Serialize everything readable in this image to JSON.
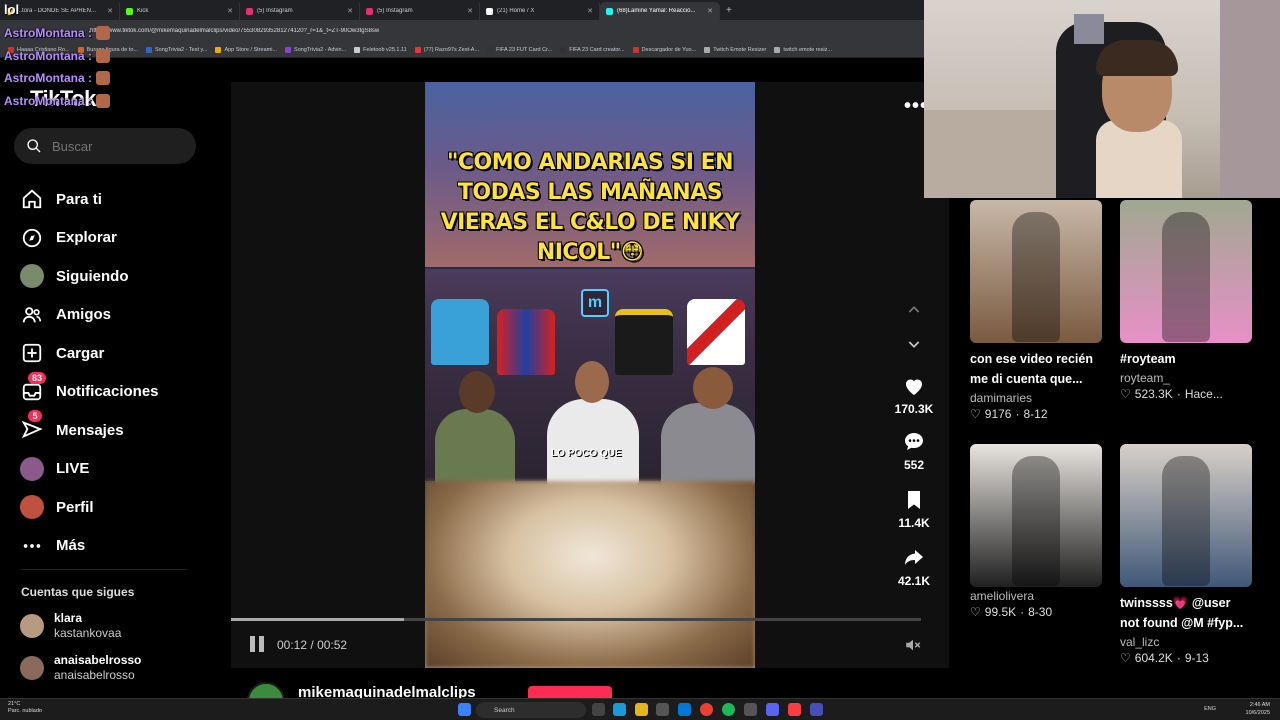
{
  "browser": {
    "tabs": [
      {
        "label": "...tora - DONDE SE APREN...",
        "color": "#f0c040"
      },
      {
        "label": "Kick",
        "color": "#53fc18"
      },
      {
        "label": "(5) Instagram",
        "color": "#e1306c"
      },
      {
        "label": "(5) Instagram",
        "color": "#e1306c"
      },
      {
        "label": "(21) Home / X",
        "color": "#ffffff"
      },
      {
        "label": "(68)Lamine Yamal: Reacció...",
        "color": "#25f4ee",
        "active": true
      }
    ],
    "new_tab": "+",
    "url": "https://www.tiktok.com/@mikemaquinadelmalclips/video/7553082935281274120?_r=1&_t=ZT-90Ow3tgS8sw",
    "bookmarks": [
      {
        "label": "Haaaa Cristiano Ro...",
        "color": "#cc3333"
      },
      {
        "label": "Burago figura de to...",
        "color": "#cc6633"
      },
      {
        "label": "SongTrivia2 - Test y...",
        "color": "#3366cc"
      },
      {
        "label": "App Store / Streami...",
        "color": "#eeaa00"
      },
      {
        "label": "SongTrivia2 - Advin...",
        "color": "#8844cc"
      },
      {
        "label": "Feletoob v25.1.11",
        "color": "#cccccc"
      },
      {
        "label": "(77) Razo97s Zest-A...",
        "color": "#ee3333"
      },
      {
        "label": "FIFA 23 FUT Card Cr...",
        "color": "#333333"
      },
      {
        "label": "FIFA 23 Card creator...",
        "color": "#333333"
      },
      {
        "label": "Descargador de Yuo...",
        "color": "#cc3333"
      },
      {
        "label": "Twitch Emote Resizer",
        "color": "#aaaaaa"
      },
      {
        "label": "twitch emote resiz...",
        "color": "#aaaaaa"
      }
    ]
  },
  "chat": {
    "top_text": "lol",
    "messages": [
      {
        "user": "AstroMontana :"
      },
      {
        "user": "AstroMontana :"
      },
      {
        "user": "AstroMontana :"
      },
      {
        "user": "AstroMontana :"
      }
    ]
  },
  "sidebar": {
    "logo": "TikTok",
    "search_placeholder": "Buscar",
    "items": [
      {
        "label": "Para ti",
        "icon": "home-icon"
      },
      {
        "label": "Explorar",
        "icon": "compass-icon"
      },
      {
        "label": "Siguiendo",
        "icon": "following-avatar"
      },
      {
        "label": "Amigos",
        "icon": "friends-icon"
      },
      {
        "label": "Cargar",
        "icon": "upload-icon"
      },
      {
        "label": "Notificaciones",
        "icon": "inbox-icon",
        "badge": "83"
      },
      {
        "label": "Mensajes",
        "icon": "message-icon",
        "badge": "5"
      },
      {
        "label": "LIVE",
        "icon": "live-avatar"
      },
      {
        "label": "Perfil",
        "icon": "profile-avatar"
      },
      {
        "label": "Más",
        "icon": "more-icon"
      }
    ],
    "following_title": "Cuentas que sigues",
    "following": [
      {
        "name": "klara",
        "sub": "kastankovaa"
      },
      {
        "name": "anaisabelrosso",
        "sub": "anaisabelrosso"
      }
    ]
  },
  "video": {
    "headline": "\"COMO ANDARIAS SI EN TODAS LAS MAÑANAS VIERAS EL C&LO DE NIKY NICOL\"😳",
    "caption": "LO POCO QUE",
    "logo_letter": "m",
    "current_time": "00:12",
    "duration": "00:52",
    "separator": "/",
    "progress": 0.25,
    "author": "mikemaquinadelmalclips"
  },
  "actions": [
    {
      "icon": "heart-icon",
      "count": "170.3K"
    },
    {
      "icon": "comment-icon",
      "count": "552"
    },
    {
      "icon": "bookmark-icon",
      "count": "11.4K"
    },
    {
      "icon": "share-icon",
      "count": "42.1K"
    }
  ],
  "related": [
    {
      "desc": "con ese video recién me di cuenta que...",
      "user": "damimaries",
      "likes": "9176",
      "date": "8-12",
      "colors": [
        "#c8b8a8",
        "#7a5a40"
      ]
    },
    {
      "desc": "#royteam",
      "user": "royteam_",
      "likes": "523.3K",
      "date": "Hace...",
      "colors": [
        "#a0a890",
        "#e890c8"
      ]
    },
    {
      "desc": "",
      "user": "ameliolivera",
      "likes": "99.5K",
      "date": "8-30",
      "colors": [
        "#e8e4e0",
        "#202020"
      ]
    },
    {
      "desc": "twinssss💗 @user not found @M #fyp...",
      "user": "val_lizc",
      "likes": "604.2K",
      "date": "9-13",
      "colors": [
        "#d8d0c8",
        "#405878"
      ]
    }
  ],
  "taskbar": {
    "weather_temp": "21°C",
    "weather_desc": "Parc. nublado",
    "search": "Search",
    "lang": "ENG",
    "time": "2:46 AM",
    "date": "10/6/2025"
  }
}
